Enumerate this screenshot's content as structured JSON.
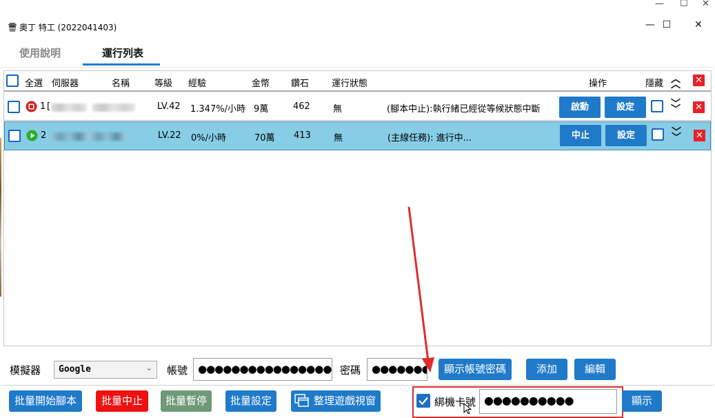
{
  "window": {
    "title": "奧丁 特工 (2022041403)",
    "outer_controls": [
      "—",
      "☐",
      "✕"
    ],
    "controls": [
      "—",
      "☐",
      "✕"
    ]
  },
  "tabs": [
    {
      "label": "使用說明",
      "active": false
    },
    {
      "label": "運行列表",
      "active": true
    }
  ],
  "table": {
    "headers": {
      "select_all": "全選",
      "server": "伺服器",
      "name": "名稱",
      "level": "等級",
      "exp": "經驗",
      "gold": "金幣",
      "diamond": "鑽石",
      "run_status": "運行狀態",
      "operation": "操作",
      "hide": "隱藏"
    },
    "rows": [
      {
        "index": "1",
        "server_prefix": "[",
        "status_icon": "stop-icon",
        "level": "LV.42",
        "exp": "1.347%/小時",
        "gold": "9萬",
        "diamond": "462",
        "run_status": "無",
        "message": "(腳本中止):執行緒已經從等候狀態中斷",
        "action_label": "啟動",
        "settings_label": "設定",
        "selected": false
      },
      {
        "index": "2",
        "server_prefix": "",
        "status_icon": "play-icon",
        "level": "LV.22",
        "exp": "0%/小時",
        "gold": "70萬",
        "diamond": "413",
        "run_status": "無",
        "message": "(主線任務): 進行中...",
        "action_label": "中止",
        "settings_label": "設定",
        "selected": true
      }
    ]
  },
  "account_bar": {
    "emulator_label": "模擬器",
    "emulator_value": "Google",
    "account_label": "帳號",
    "account_value": "●●●●●●●●●●●●●●●●●●●●",
    "password_label": "密碼",
    "password_value": "●●●●●●●●",
    "show_credentials_label": "顯示帳號密碼",
    "add_label": "添加",
    "edit_label": "編輯"
  },
  "action_bar": {
    "batch_start_label": "批量開始腳本",
    "batch_stop_label": "批量中止",
    "batch_pause_label": "批量暫停",
    "batch_settings_label": "批量設定",
    "arrange_windows_label": "整理遊戲視窗",
    "bind_card_label": "綁機卡號",
    "bind_card_checked": true,
    "bind_card_value": "●●●●●●●●●●",
    "show_label": "顯示"
  },
  "colors": {
    "accent_blue": "#1f7ac9",
    "selected_row": "#87cde6",
    "stop_red": "#ee1111",
    "pause_gray": "#6f9a78",
    "highlight_red": "#e02b2b"
  }
}
